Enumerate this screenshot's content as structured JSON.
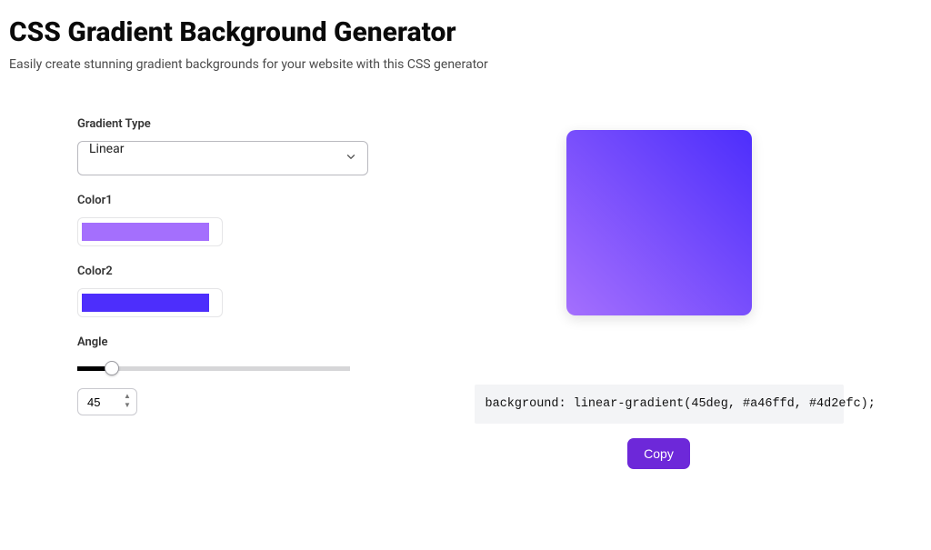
{
  "header": {
    "title": "CSS Gradient Background Generator",
    "subtitle": "Easily create stunning gradient backgrounds for your website with this CSS generator"
  },
  "form": {
    "gradient_type": {
      "label": "Gradient Type",
      "selected": "Linear"
    },
    "color1": {
      "label": "Color1",
      "value": "#a46ffd"
    },
    "color2": {
      "label": "Color2",
      "value": "#4d2efc"
    },
    "angle": {
      "label": "Angle",
      "value": "45",
      "min": 0,
      "max": 360,
      "percent": 12.5
    }
  },
  "output": {
    "code": "background: linear-gradient(45deg, #a46ffd, #4d2efc);",
    "copy_label": "Copy"
  },
  "colors": {
    "accent": "#6d28d9"
  }
}
